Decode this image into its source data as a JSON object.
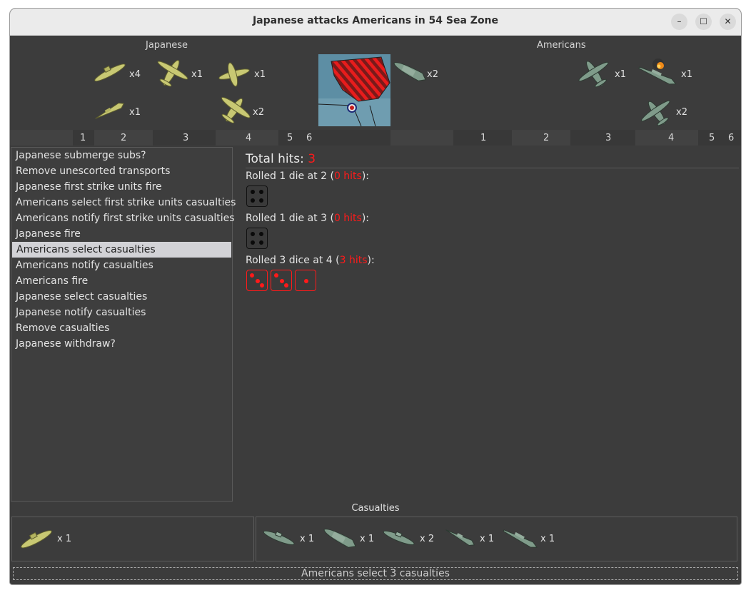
{
  "window": {
    "title": "Japanese attacks Americans in 54 Sea Zone",
    "minimize": "–",
    "maximize": "☐",
    "close": "✕"
  },
  "sides": {
    "attacker": "Japanese",
    "defender": "Americans"
  },
  "japanese_units": [
    {
      "name": "submarine",
      "count": "x4"
    },
    {
      "name": "fighter",
      "count": "x1"
    },
    {
      "name": "tactical-bomber",
      "count": "x1"
    },
    {
      "name": "destroyer",
      "count": "x1"
    },
    {
      "name": "bomber",
      "count": "x2"
    }
  ],
  "territory_units": [
    {
      "name": "transport",
      "count": "x2"
    }
  ],
  "american_units": [
    {
      "name": "fighter",
      "count": "x1"
    },
    {
      "name": "damaged-battleship",
      "count": "x1"
    },
    {
      "name": "fighter",
      "count": "x2"
    }
  ],
  "roll_ticks_left": [
    "1",
    "2",
    "3",
    "4",
    "5",
    "6"
  ],
  "roll_ticks_right": [
    "1",
    "2",
    "3",
    "4",
    "5",
    "6"
  ],
  "steps": [
    "Japanese submerge subs?",
    "Remove unescorted transports",
    "Japanese first strike units fire",
    "Americans select first strike units casualties",
    "Americans notify first strike units casualties",
    "Japanese fire",
    "Americans select casualties",
    "Americans notify casualties",
    "Americans fire",
    "Japanese select casualties",
    "Japanese notify casualties",
    "Remove casualties",
    "Japanese withdraw?"
  ],
  "selected_step": 6,
  "results": {
    "total_label": "Total hits: ",
    "total_value": "3",
    "rolls": [
      {
        "prefix": "Rolled 1 die at 2 (",
        "hits": "0 hits",
        "suffix": "):",
        "dice": [
          5
        ],
        "hit": [
          false
        ]
      },
      {
        "prefix": "Rolled 1 die at 3 (",
        "hits": "0 hits",
        "suffix": "):",
        "dice": [
          4
        ],
        "hit": [
          false
        ]
      },
      {
        "prefix": "Rolled 3 dice at 4 (",
        "hits": "3 hits",
        "suffix": "):",
        "dice": [
          3,
          3,
          1
        ],
        "hit": [
          true,
          true,
          true
        ]
      }
    ]
  },
  "casualties": {
    "title": "Casualties",
    "japanese": [
      {
        "name": "submarine",
        "count": "x 1"
      }
    ],
    "american": [
      {
        "name": "submarine",
        "count": "x 1"
      },
      {
        "name": "transport",
        "count": "x 1"
      },
      {
        "name": "submarine",
        "count": "x 2"
      },
      {
        "name": "destroyer",
        "count": "x 1"
      },
      {
        "name": "battleship",
        "count": "x 1"
      }
    ]
  },
  "status": "Americans select 3 casualties",
  "colors": {
    "japanese_unit": "#c8c873",
    "american_unit": "#7f9b8a",
    "hit_red": "#ff1a1a"
  }
}
